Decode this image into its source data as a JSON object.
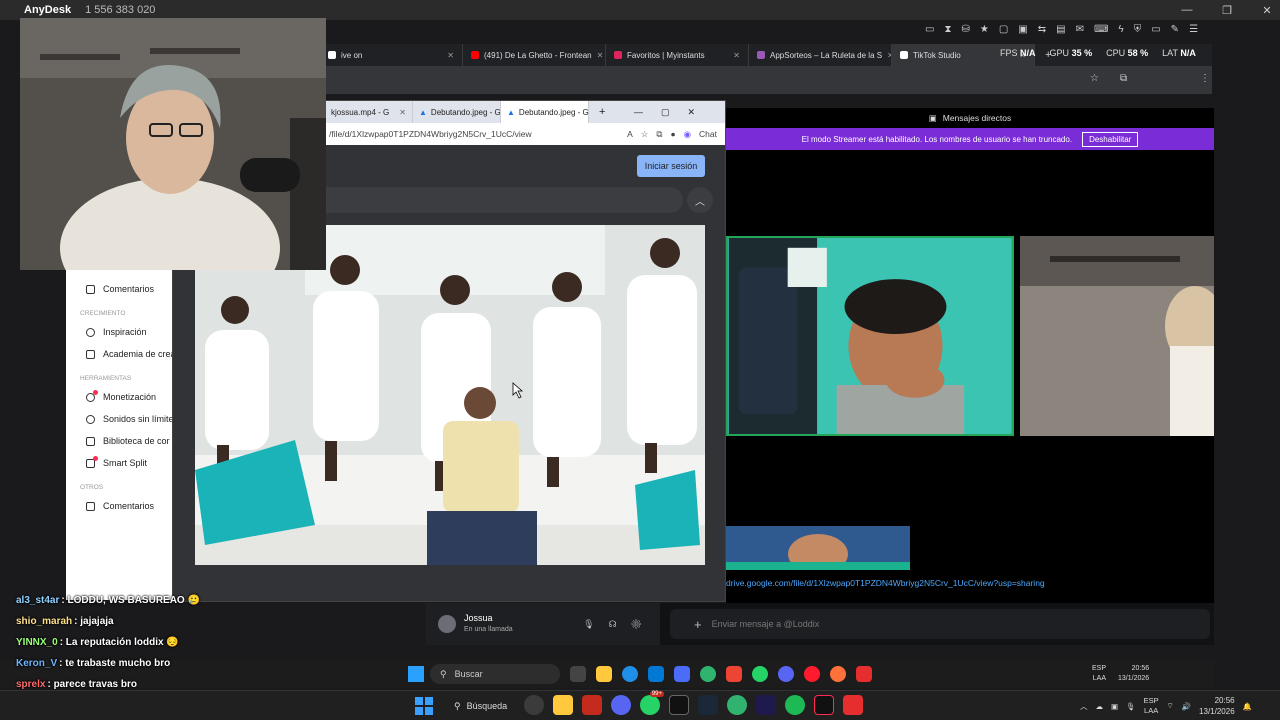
{
  "anydesk": {
    "title": "AnyDesk",
    "id": "1 556 383 020"
  },
  "browser_tabs": [
    {
      "label": "ive on",
      "color": "#ffffff"
    },
    {
      "label": "(491) De La Ghetto - Frontean",
      "color": "#ff0000"
    },
    {
      "label": "Favoritos | Myinstants",
      "color": "#e0245e"
    },
    {
      "label": "AppSorteos – La Ruleta de la S",
      "color": "#9b59b6"
    },
    {
      "label": "TikTok Studio",
      "color": "#ffffff"
    }
  ],
  "obs_stats": {
    "fps_label": "FPS",
    "fps": "N/A",
    "gpu_label": "GPU",
    "gpu": "35 %",
    "cpu_label": "CPU",
    "cpu": "58 %",
    "lat_label": "LAT",
    "lat": "N/A"
  },
  "tiktok_sidebar": {
    "items_top": [
      {
        "label": "Comentarios",
        "icon": "comment-icon"
      }
    ],
    "section_growth": "CRECIMIENTO",
    "items_growth": [
      {
        "label": "Inspiración",
        "icon": "bulb-icon"
      },
      {
        "label": "Academia de crea",
        "icon": "academy-icon"
      }
    ],
    "section_tools": "HERRAMIENTAS",
    "items_tools": [
      {
        "label": "Monetización",
        "icon": "monetization-icon",
        "dot": true
      },
      {
        "label": "Sonidos sin límite",
        "icon": "music-icon",
        "dot": false
      },
      {
        "label": "Biblioteca de cor",
        "icon": "library-icon",
        "dot": false
      },
      {
        "label": "Smart Split",
        "icon": "split-icon",
        "dot": true
      }
    ],
    "section_other": "OTROS",
    "items_other": [
      {
        "label": "Comentarios",
        "icon": "comment-icon"
      }
    ]
  },
  "viewer": {
    "tabs": [
      {
        "label": "kjossua.mp4 - G"
      },
      {
        "label": "Debutando.jpeg - G"
      },
      {
        "label": "Debutando.jpeg - G",
        "active": true
      }
    ],
    "url": "/file/d/1Xlzwpap0T1PZDN4Wbriyg2N5Crv_1UcC/view",
    "chat_label": "Chat",
    "login_label": "Iniciar sesión"
  },
  "discord": {
    "header": "Mensajes directos",
    "banner_text": "El modo Streamer está habilitado. Los nombres de usuario se han truncado.",
    "banner_button": "Deshabilitar",
    "link": "drive.google.com/file/d/1Xlzwpap0T1PZDN4Wbriyg2N5Crv_1UcC/view?usp=sharing",
    "voice_user": "Jossua",
    "voice_status": "En una llamada",
    "message_placeholder": "Enviar mensaje a @Loddix"
  },
  "remote_taskbar": {
    "search": "Buscar",
    "lang": "ESP\nLAA",
    "time": "20:56",
    "date": "13/1/2026"
  },
  "chat": [
    {
      "name": "al3_st4ar",
      "text": ": LODDU, WS BASUREAO 🥲",
      "color": "#8fd1ff"
    },
    {
      "name": "shio_marah",
      "text": ": jajajaja",
      "color": "#ffe08a"
    },
    {
      "name": "YINNX_0",
      "text": ": La reputación loddix 😔",
      "color": "#9cff7a"
    },
    {
      "name": "Keron_V",
      "text": ": te trabaste mucho bro",
      "color": "#6fb3ff"
    },
    {
      "name": "sprelx",
      "text": ": parece travas bro",
      "color": "#ff6b6b"
    }
  ],
  "taskbar": {
    "search": "Búsqueda",
    "badge": "99+",
    "lang": "ESP\nLAA",
    "time": "20:56",
    "date": "13/1/2026"
  }
}
